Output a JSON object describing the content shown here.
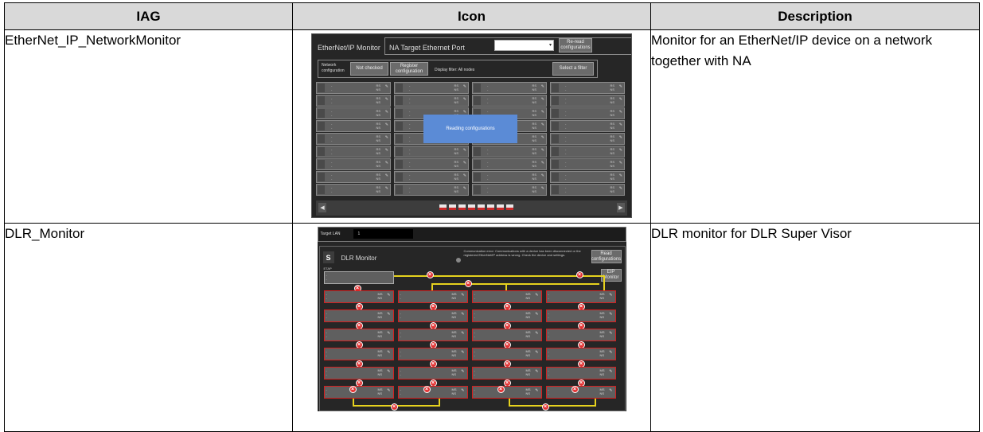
{
  "table": {
    "headers": [
      "IAG",
      "Icon",
      "Description"
    ],
    "rows": [
      {
        "name": "EtherNet_IP_NetworkMonitor",
        "description": "Monitor for an EtherNet/IP device on a network together with NA"
      },
      {
        "name": "DLR_Monitor",
        "description": "DLR monitor for DLR Super Visor"
      }
    ]
  },
  "screen1": {
    "title": "EtherNet/IP  Monitor",
    "na_target": "NA  Target  Ethernet Port",
    "reread": "Re-read configurations",
    "network_config": "Network configuration",
    "not_checked": "Not checked",
    "register": "Register configuration",
    "display_filter": "Display filter: All nodes",
    "select_filter": "Select a filter",
    "overlay": "Reading configurations",
    "prev": "◀",
    "next": "▶",
    "cell_left": "-\n-",
    "cell_right": "RS\nNS"
  },
  "screen2": {
    "target_label": "Target LAN",
    "target_value": "1",
    "badge": "S",
    "title": "DLR Monitor",
    "error": "Communication error: Communications with a device has been disconnected or the registered EtherNet/IP address is wrong. Check the device and settings.",
    "read_config": "Read configurations",
    "eip_monitor": "EIP Monitor",
    "etap": "ETAP",
    "cell_left": "-\n-",
    "cell_right": "MS\nNS"
  },
  "colors": {
    "header_bg": "#d9d9d9",
    "screen_bg": "#262626",
    "overlay_bg": "#5b8bd6",
    "error_red": "#d41f1f",
    "ring_yellow": "#e6d21e"
  }
}
